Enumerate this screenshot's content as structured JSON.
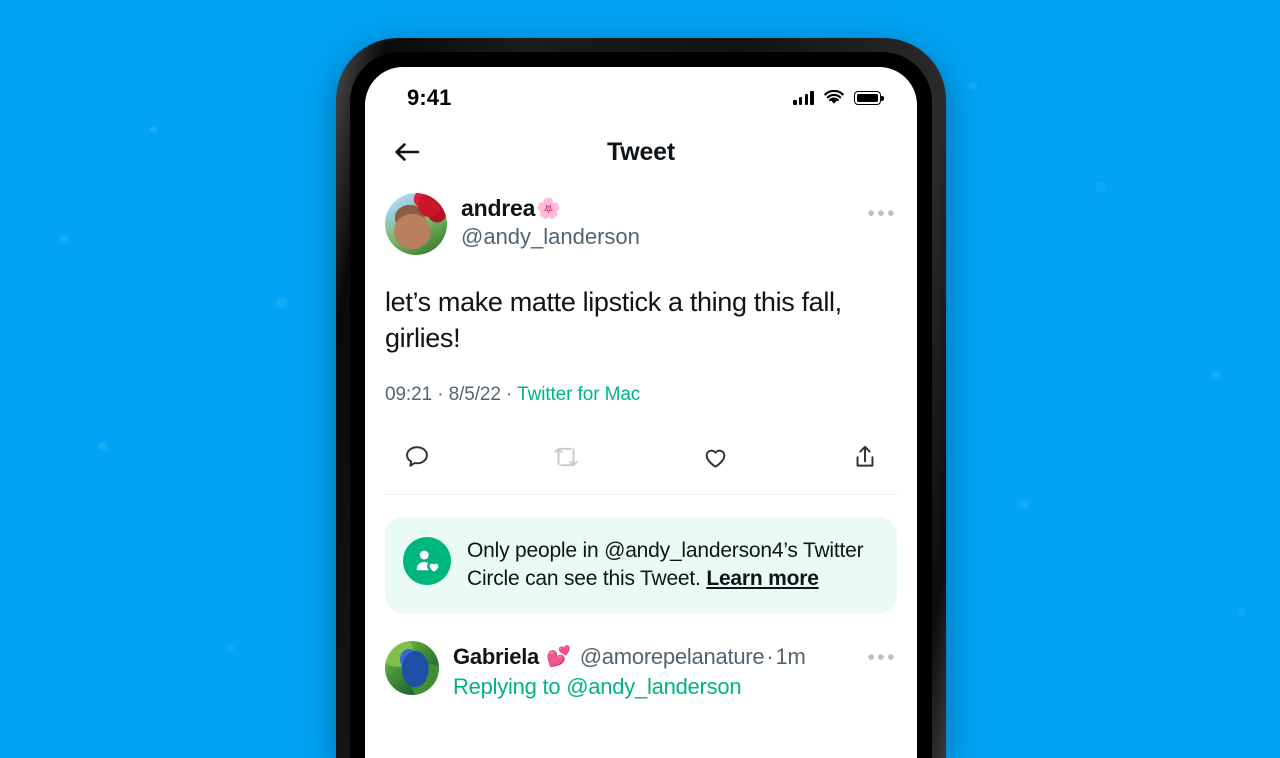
{
  "background": {
    "color": "#00A3F5"
  },
  "device": {
    "frame_color": "#121212",
    "screen_color": "#FFFFFF"
  },
  "status_bar": {
    "time": "9:41",
    "signal_icon": "cellular-signal-icon",
    "wifi_icon": "wifi-icon",
    "battery_icon": "battery-full-icon"
  },
  "nav": {
    "back_icon": "back-arrow-icon",
    "title": "Tweet"
  },
  "tweet": {
    "author": {
      "display_name": "andrea",
      "name_emoji": "🌸",
      "handle": "@andy_landerson",
      "avatar": "avatar-andrea"
    },
    "more_label": "•••",
    "text": "let’s make matte lipstick a thing this fall, girlies!",
    "meta": {
      "time": "09:21",
      "separator": " · ",
      "date": "8/5/22",
      "source": "Twitter for Mac",
      "source_color": "#00B386"
    },
    "actions": [
      {
        "name": "reply-icon",
        "label": "Reply"
      },
      {
        "name": "retweet-icon",
        "label": "Retweet"
      },
      {
        "name": "like-icon",
        "label": "Like"
      },
      {
        "name": "share-icon",
        "label": "Share"
      }
    ]
  },
  "circle_banner": {
    "icon": "twitter-circle-icon",
    "icon_color": "#00B67F",
    "background_color": "#E9FBF4",
    "text": "Only people in @andy_landerson4’s Twitter Circle can see this Tweet. ",
    "link_label": "Learn more"
  },
  "reply": {
    "author": {
      "display_name": "Gabriela",
      "name_emoji": "💕",
      "handle": "@amorepelanature",
      "avatar": "avatar-gabriela"
    },
    "separator": " · ",
    "timestamp": "1m",
    "more_label": "•••",
    "replying_to_prefix": "Replying to ",
    "replying_to_handle": "@andy_landerson"
  }
}
